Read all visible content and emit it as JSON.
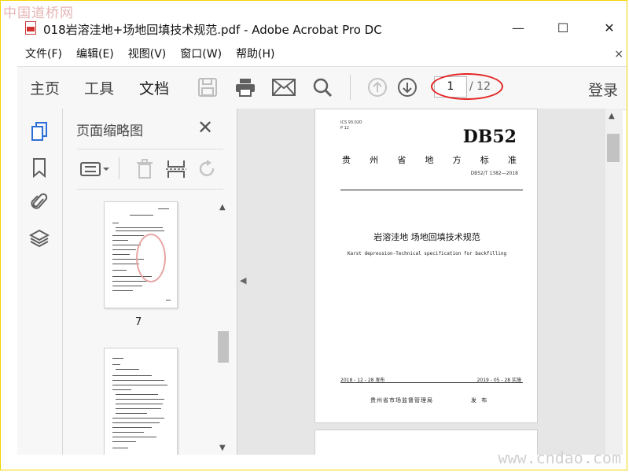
{
  "watermark": {
    "top": "中国道桥网",
    "bottom": "www.cndao.com"
  },
  "window": {
    "title": "018岩溶洼地+场地回填技术规范.pdf - Adobe Acrobat Pro DC",
    "minimize": "—",
    "maximize": "☐",
    "close": "✕"
  },
  "menubar": {
    "items": [
      "文件(F)",
      "编辑(E)",
      "视图(V)",
      "窗口(W)",
      "帮助(H)"
    ],
    "close": "×"
  },
  "toolbar": {
    "tabs": [
      "主页",
      "工具",
      "文档"
    ],
    "active_tab": "文档",
    "page_current": "1",
    "page_total": "/ 12",
    "login": "登录",
    "icons": [
      "save-icon",
      "print-icon",
      "email-icon",
      "search-icon",
      "page-up-icon",
      "page-down-icon"
    ]
  },
  "rail": {
    "icons": [
      "pages-icon",
      "bookmark-icon",
      "attachment-icon",
      "layers-icon"
    ]
  },
  "thumbnails": {
    "title": "页面缩略图",
    "close": "✕",
    "tools": [
      "options-icon",
      "delete-icon",
      "crop-icon",
      "rotate-icon"
    ],
    "pages": [
      {
        "number": "7"
      },
      {
        "number": ""
      }
    ]
  },
  "document": {
    "ics": "ICS 93.020",
    "ccs": "P 12",
    "db": "DB52",
    "province": [
      "贵",
      "州",
      "省",
      "地",
      "方",
      "标",
      "准"
    ],
    "code": "DB52/T 1382—2018",
    "title": "岩溶洼地  场地回填技术规范",
    "english_title": "Karst depression-Technical specification for backfilling",
    "issue_date": "2018 - 12 - 28 发布",
    "impl_date": "2019 - 05 - 28 实施",
    "issuer": "贵州省市场监督管理局",
    "publish": "发 布"
  },
  "colors": {
    "accent": "#e32222",
    "icon": "#5f5f5f",
    "rail_icon": "#2d6fd6"
  }
}
